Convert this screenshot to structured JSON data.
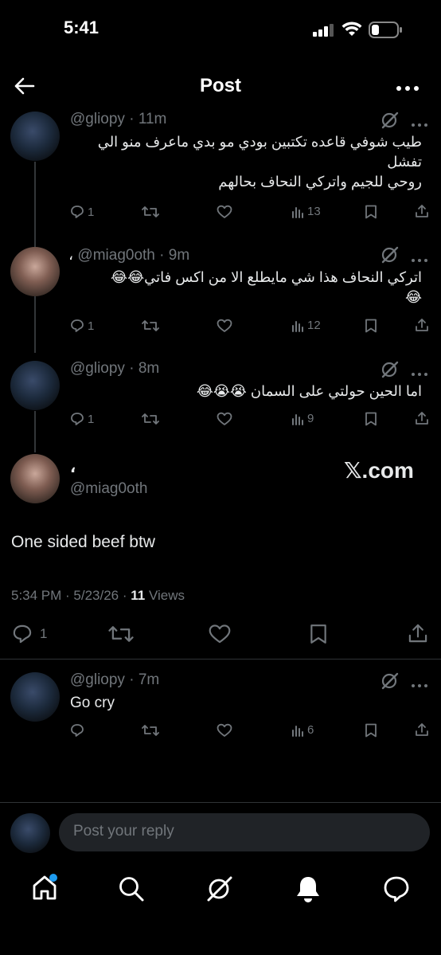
{
  "status_bar": {
    "time": "5:41"
  },
  "header": {
    "title": "Post"
  },
  "thread": [
    {
      "handle": "@gliopy",
      "time": "· 11m",
      "lines": [
        "طيب شوفي قاعده تكتبين بودي مو بدي ماعرف منو الي",
        "تفشل",
        "روحي للجيم واتركي النحاف بحالهم"
      ],
      "replies": "1",
      "views": "13"
    },
    {
      "display_name": "،",
      "handle": "@miag0oth",
      "time": "· 9m",
      "lines": [
        "اتركي النحاف هذا شي مايطلع الا من  اكس فاتي😂😂",
        "😂"
      ],
      "replies": "1",
      "views": "12"
    },
    {
      "handle": "@gliopy",
      "time": "· 8m",
      "lines": [
        "اما الحين حولتي على السمان 😭😭😂"
      ],
      "replies": "1",
      "views": "9"
    }
  ],
  "main_post": {
    "display_name": "،",
    "handle": "@miag0oth",
    "source_label": "𝕏.com",
    "text": "One sided beef btw",
    "meta": "5:34 PM · 5/23/26 · ",
    "views_count": "11",
    "views_label": " Views",
    "replies": "1"
  },
  "reply": {
    "handle": "@gliopy",
    "time": "· 7m",
    "text": "Go cry",
    "views": "6"
  },
  "compose": {
    "placeholder": "Post your reply"
  },
  "colors": {
    "accent": "#1d9bf0",
    "muted": "#71767b",
    "text": "#e7e9ea",
    "background": "#000000"
  }
}
